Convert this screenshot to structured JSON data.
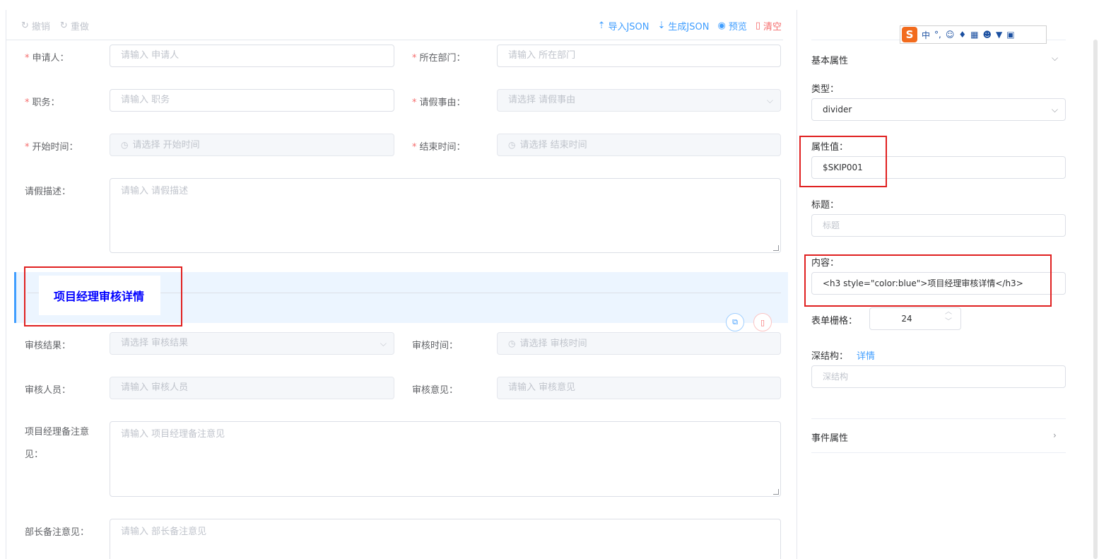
{
  "toolbar": {
    "undo": "撤销",
    "redo": "重做",
    "import_json": "导入JSON",
    "generate_json": "生成JSON",
    "preview": "预览",
    "clear": "清空"
  },
  "form": {
    "applicant": {
      "label": "申请人：",
      "placeholder": "请输入 申请人"
    },
    "department": {
      "label": "所在部门：",
      "placeholder": "请输入 所在部门"
    },
    "position": {
      "label": "职务：",
      "placeholder": "请输入 职务"
    },
    "leave_reason": {
      "label": "请假事由：",
      "placeholder": "请选择 请假事由"
    },
    "start_time": {
      "label": "开始时间：",
      "placeholder": "请选择 开始时间"
    },
    "end_time": {
      "label": "结束时间：",
      "placeholder": "请选择 结束时间"
    },
    "leave_desc": {
      "label": "请假描述：",
      "placeholder": "请输入 请假描述"
    },
    "divider_title": "项目经理审核详情",
    "review_result": {
      "label": "审核结果：",
      "placeholder": "请选择 审核结果"
    },
    "review_time": {
      "label": "审核时间：",
      "placeholder": "请选择 审核时间"
    },
    "reviewer": {
      "label": "审核人员：",
      "placeholder": "请输入 审核人员"
    },
    "review_opinion": {
      "label": "审核意见：",
      "placeholder": "请输入 审核意见"
    },
    "pm_remark": {
      "label_line1": "项目经理备注意",
      "label_line2": "见：",
      "placeholder": "请输入 项目经理备注意见"
    },
    "minister_remark": {
      "label": "部长备注意见：",
      "placeholder": "请输入 部长备注意见"
    }
  },
  "panel": {
    "basic_props": "基本属性",
    "type_label": "类型：",
    "type_value": "divider",
    "prop_value_label": "属性值：",
    "prop_value": "$SKIP001",
    "title_label": "标题：",
    "title_placeholder": "标题",
    "content_label": "内容：",
    "content_value": "<h3 style=\"color:blue\">项目经理审核详情</h3>",
    "grid_label": "表单栅格：",
    "grid_value": "24",
    "deep_label": "深结构：",
    "deep_link": "详情",
    "deep_placeholder": "深结构",
    "event_props": "事件属性"
  },
  "ime": {
    "zh": "中",
    "punct": "°,"
  }
}
